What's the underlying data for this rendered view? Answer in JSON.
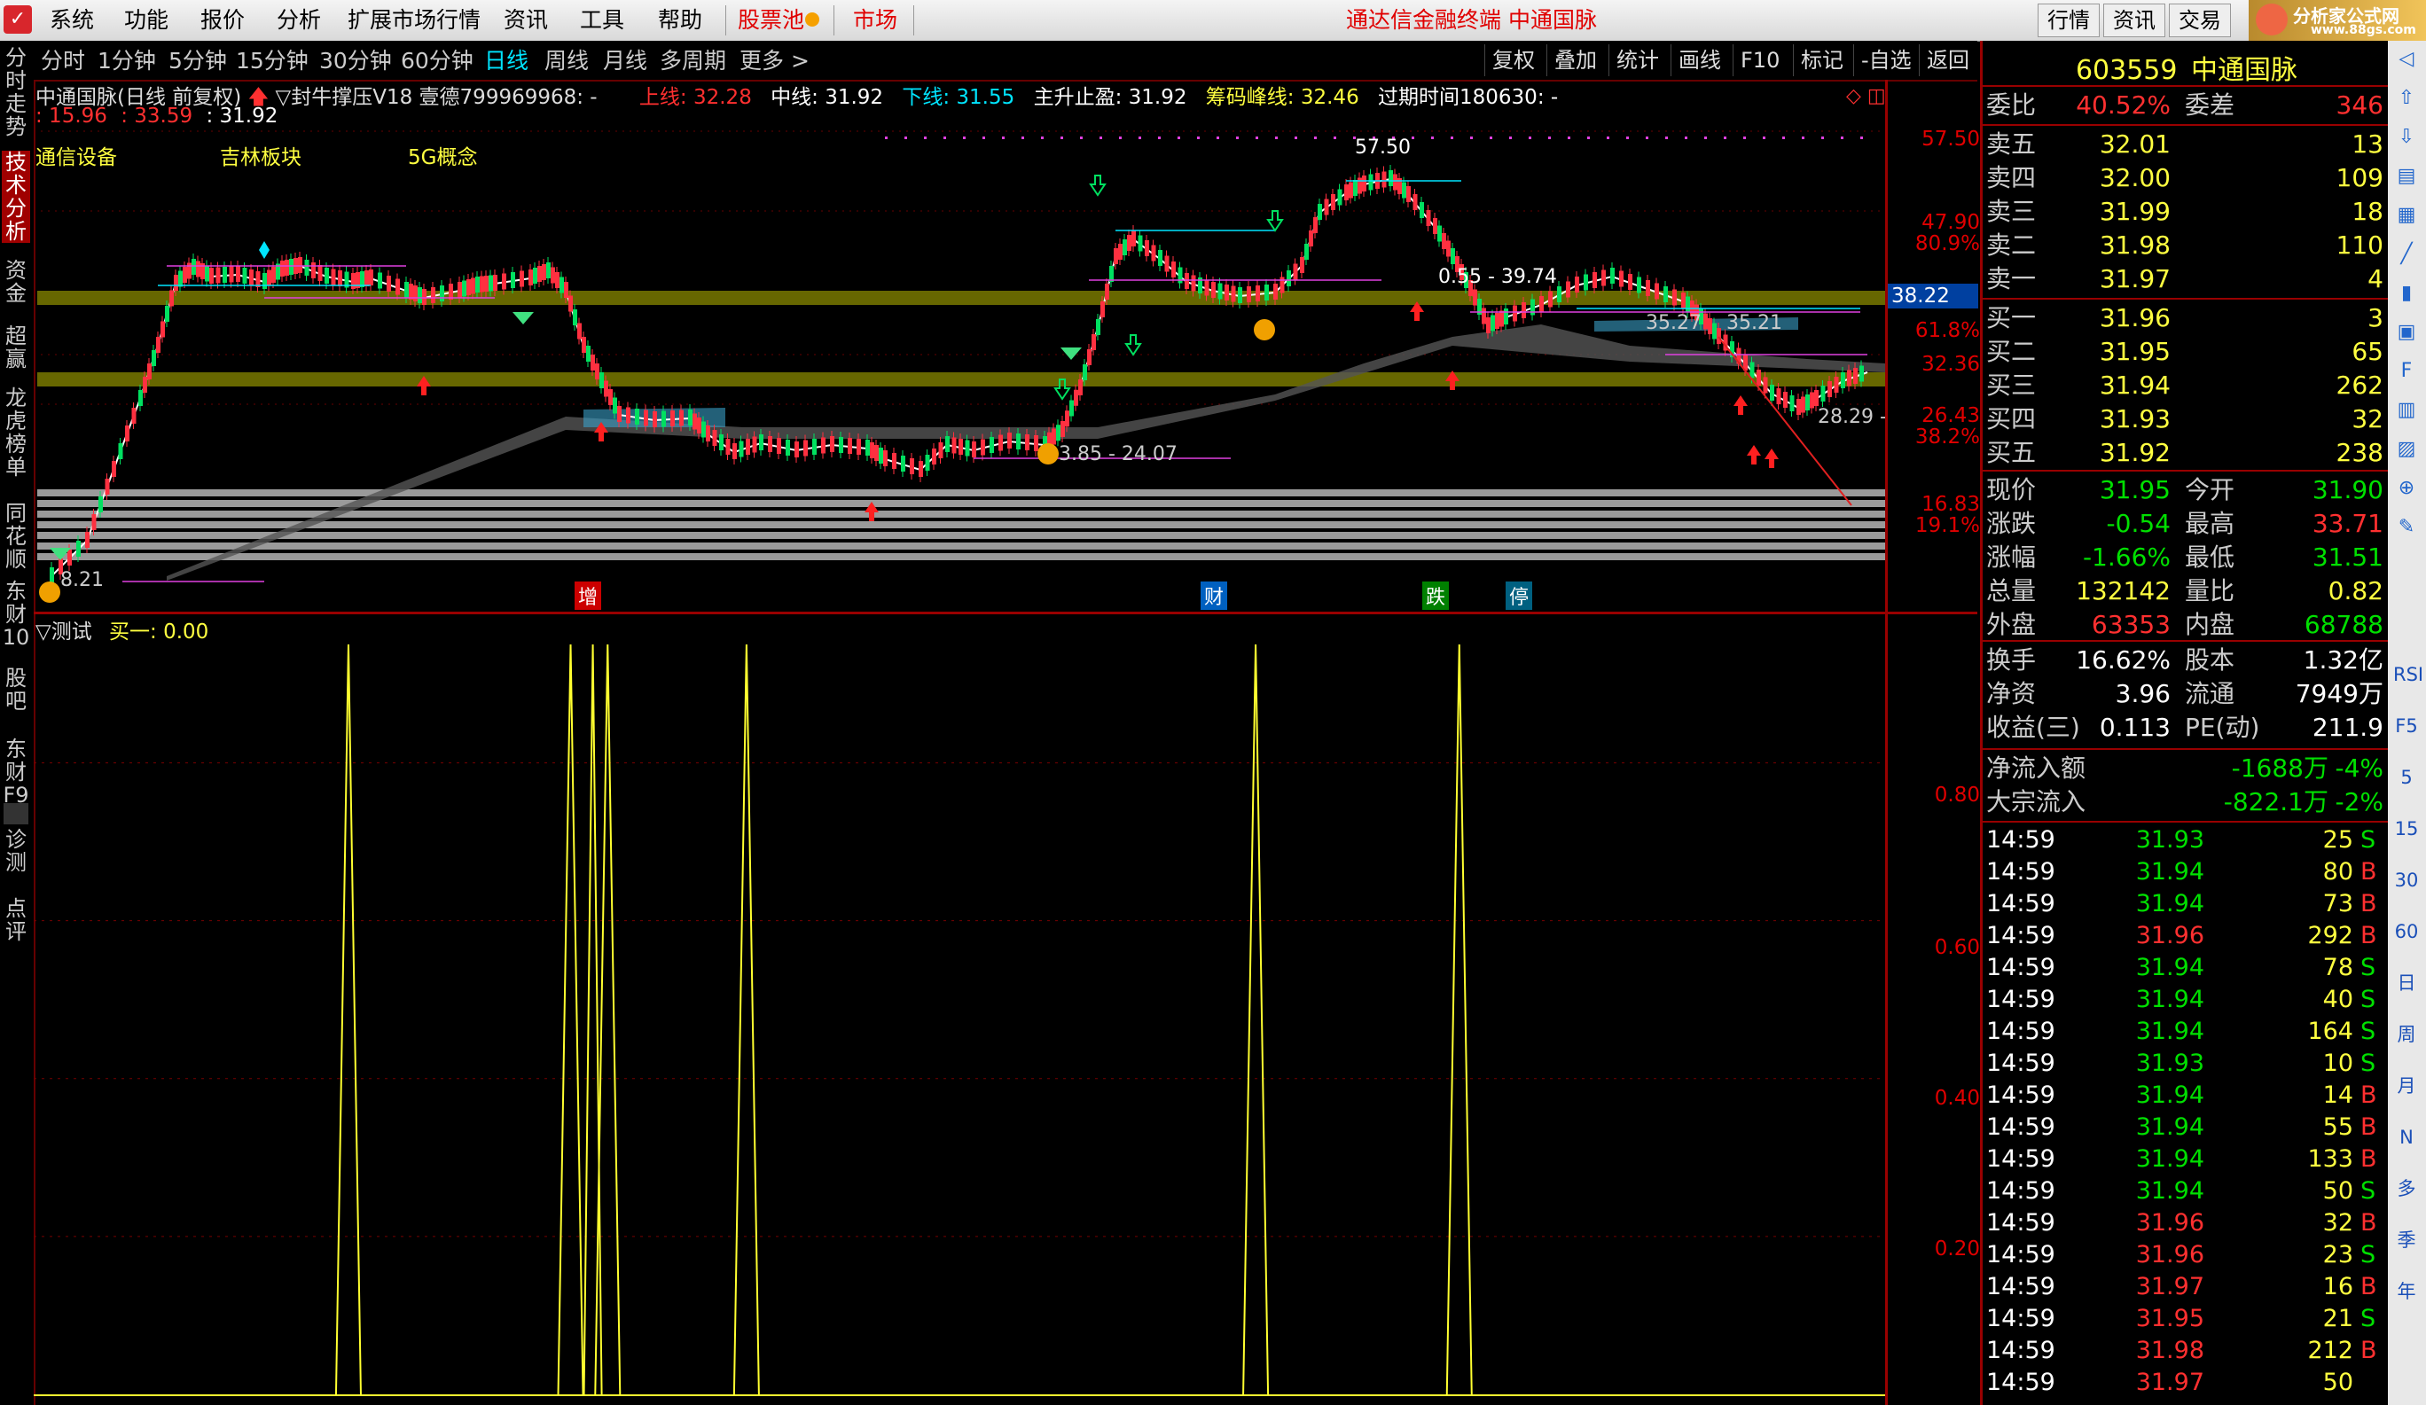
{
  "menu": {
    "items": [
      "系统",
      "功能",
      "报价",
      "分析",
      "扩展市场行情",
      "资讯",
      "工具",
      "帮助"
    ],
    "stock_pool": "股票池",
    "market": "市场",
    "title": "通达信金融终端  中通国脉",
    "buttons": [
      "行情",
      "资讯",
      "交易"
    ],
    "brand_text": "分析家公式网",
    "brand_url": "www.88gs.com"
  },
  "left_tabs": [
    {
      "label": "分时走势",
      "active": false
    },
    {
      "label": "技术分析",
      "active": true
    },
    {
      "label": "资金",
      "active": false
    },
    {
      "label": "超赢",
      "active": false
    },
    {
      "label": "龙虎榜单",
      "active": false
    },
    {
      "label": "同花顺",
      "active": false
    },
    {
      "label": "东财10",
      "active": false
    },
    {
      "label": "股吧",
      "active": false
    },
    {
      "label": "东财F9",
      "active": false
    },
    {
      "label": "诊测",
      "active": false
    },
    {
      "label": "点评",
      "active": false
    }
  ],
  "periods": {
    "items": [
      "分时",
      "1分钟",
      "5分钟",
      "15分钟",
      "30分钟",
      "60分钟",
      "日线",
      "周线",
      "月线",
      "多周期",
      "更多 >"
    ],
    "active": "日线"
  },
  "toolbar": [
    "复权",
    "叠加",
    "统计",
    "画线",
    "F10",
    "标记",
    "-自选",
    "返回"
  ],
  "chart_header": {
    "name": "中通国脉(日线 前复权)",
    "indicator": "▽封牛撑压V18 壹德799969968: -",
    "upper_label": "上线: 32.28",
    "mid_label": "中线: 31.92",
    "lower_label": "下线: 31.55",
    "stop_label": "主升止盈: 31.92",
    "chip_label": "筹码峰线: 32.46",
    "expire_label": "过期时间180630: -",
    "line2_a": ": 15.96",
    "line2_b": ": 33.59",
    "line2_c": ": 31.92",
    "sectors": [
      "通信设备",
      "吉林板块",
      "5G概念"
    ]
  },
  "annotations": {
    "high": "57.50",
    "range1": "0.55 - 39.74",
    "range2": "35.27    35.21",
    "range3": "3.85 - 24.07",
    "label_28": "28.29 -",
    "low_label": "8.21",
    "event_zeng": "增",
    "event_cai": "财",
    "event_die": "跌",
    "event_ting": "停"
  },
  "yaxis_main": [
    "57.50",
    "47.90",
    "80.9%",
    "61.8%",
    "32.36",
    "26.43",
    "38.2%",
    "16.83",
    "19.1%"
  ],
  "price_tag": "38.22",
  "subchart": {
    "title": "▽测试",
    "value_label": "买一: 0.00",
    "yticks": [
      "0.80",
      "0.60",
      "0.40",
      "0.20"
    ],
    "spikes": [
      0.17,
      0.29,
      0.31,
      0.385,
      0.66,
      0.77
    ]
  },
  "quote": {
    "code": "603559",
    "name": "中通国脉",
    "weibi_label": "委比",
    "weibi": "40.52%",
    "weicha_label": "委差",
    "weicha": "346",
    "asks": [
      {
        "label": "卖五",
        "price": "32.01",
        "vol": "13"
      },
      {
        "label": "卖四",
        "price": "32.00",
        "vol": "109"
      },
      {
        "label": "卖三",
        "price": "31.99",
        "vol": "18"
      },
      {
        "label": "卖二",
        "price": "31.98",
        "vol": "110"
      },
      {
        "label": "卖一",
        "price": "31.97",
        "vol": "4"
      }
    ],
    "bids": [
      {
        "label": "买一",
        "price": "31.96",
        "vol": "3"
      },
      {
        "label": "买二",
        "price": "31.95",
        "vol": "65"
      },
      {
        "label": "买三",
        "price": "31.94",
        "vol": "262"
      },
      {
        "label": "买四",
        "price": "31.93",
        "vol": "32"
      },
      {
        "label": "买五",
        "price": "31.92",
        "vol": "238"
      }
    ],
    "stats": [
      {
        "l1": "现价",
        "v1": "31.95",
        "c1": "green",
        "l2": "今开",
        "v2": "31.90",
        "c2": "green"
      },
      {
        "l1": "涨跌",
        "v1": "-0.54",
        "c1": "green",
        "l2": "最高",
        "v2": "33.71",
        "c2": "red"
      },
      {
        "l1": "涨幅",
        "v1": "-1.66%",
        "c1": "green",
        "l2": "最低",
        "v2": "31.51",
        "c2": "green"
      },
      {
        "l1": "总量",
        "v1": "132142",
        "c1": "yellow",
        "l2": "量比",
        "v2": "0.82",
        "c2": "yellow"
      },
      {
        "l1": "外盘",
        "v1": "63353",
        "c1": "red",
        "l2": "内盘",
        "v2": "68788",
        "c2": "green"
      }
    ],
    "fund": [
      {
        "l1": "换手",
        "v1": "16.62%",
        "l2": "股本",
        "v2": "1.32亿"
      },
      {
        "l1": "净资",
        "v1": "3.96",
        "l2": "流通",
        "v2": "7949万"
      },
      {
        "l1": "收益(三)",
        "v1": "0.113",
        "l2": "PE(动)",
        "v2": "211.9"
      }
    ],
    "flows": [
      {
        "label": "净流入额",
        "value": "-1688万",
        "pct": "-4%"
      },
      {
        "label": "大宗流入",
        "value": "-822.1万",
        "pct": "-2%"
      }
    ],
    "ticks": [
      {
        "t": "14:59",
        "p": "31.93",
        "v": "25",
        "s": "S"
      },
      {
        "t": "14:59",
        "p": "31.94",
        "v": "80",
        "s": "B"
      },
      {
        "t": "14:59",
        "p": "31.94",
        "v": "73",
        "s": "B"
      },
      {
        "t": "14:59",
        "p": "31.96",
        "v": "292",
        "s": "B"
      },
      {
        "t": "14:59",
        "p": "31.94",
        "v": "78",
        "s": "S"
      },
      {
        "t": "14:59",
        "p": "31.94",
        "v": "40",
        "s": "S"
      },
      {
        "t": "14:59",
        "p": "31.94",
        "v": "164",
        "s": "S"
      },
      {
        "t": "14:59",
        "p": "31.93",
        "v": "10",
        "s": "S"
      },
      {
        "t": "14:59",
        "p": "31.94",
        "v": "14",
        "s": "B"
      },
      {
        "t": "14:59",
        "p": "31.94",
        "v": "55",
        "s": "B"
      },
      {
        "t": "14:59",
        "p": "31.94",
        "v": "133",
        "s": "B"
      },
      {
        "t": "14:59",
        "p": "31.94",
        "v": "50",
        "s": "S"
      },
      {
        "t": "14:59",
        "p": "31.96",
        "v": "32",
        "s": "B"
      },
      {
        "t": "14:59",
        "p": "31.96",
        "v": "23",
        "s": "S"
      },
      {
        "t": "14:59",
        "p": "31.97",
        "v": "16",
        "s": "B"
      },
      {
        "t": "14:59",
        "p": "31.95",
        "v": "21",
        "s": "S"
      },
      {
        "t": "14:59",
        "p": "31.98",
        "v": "212",
        "s": "B"
      },
      {
        "t": "14:59",
        "p": "31.97",
        "v": "50",
        "s": ""
      }
    ]
  },
  "right_strip": [
    "RSI",
    "F5",
    "5",
    "15",
    "30",
    "60",
    "日",
    "周",
    "月",
    "N",
    "多",
    "季",
    "年"
  ],
  "colors": {
    "up": "#ff3030",
    "down": "#00e000",
    "accent": "#00e5ff",
    "frame": "#990000"
  }
}
